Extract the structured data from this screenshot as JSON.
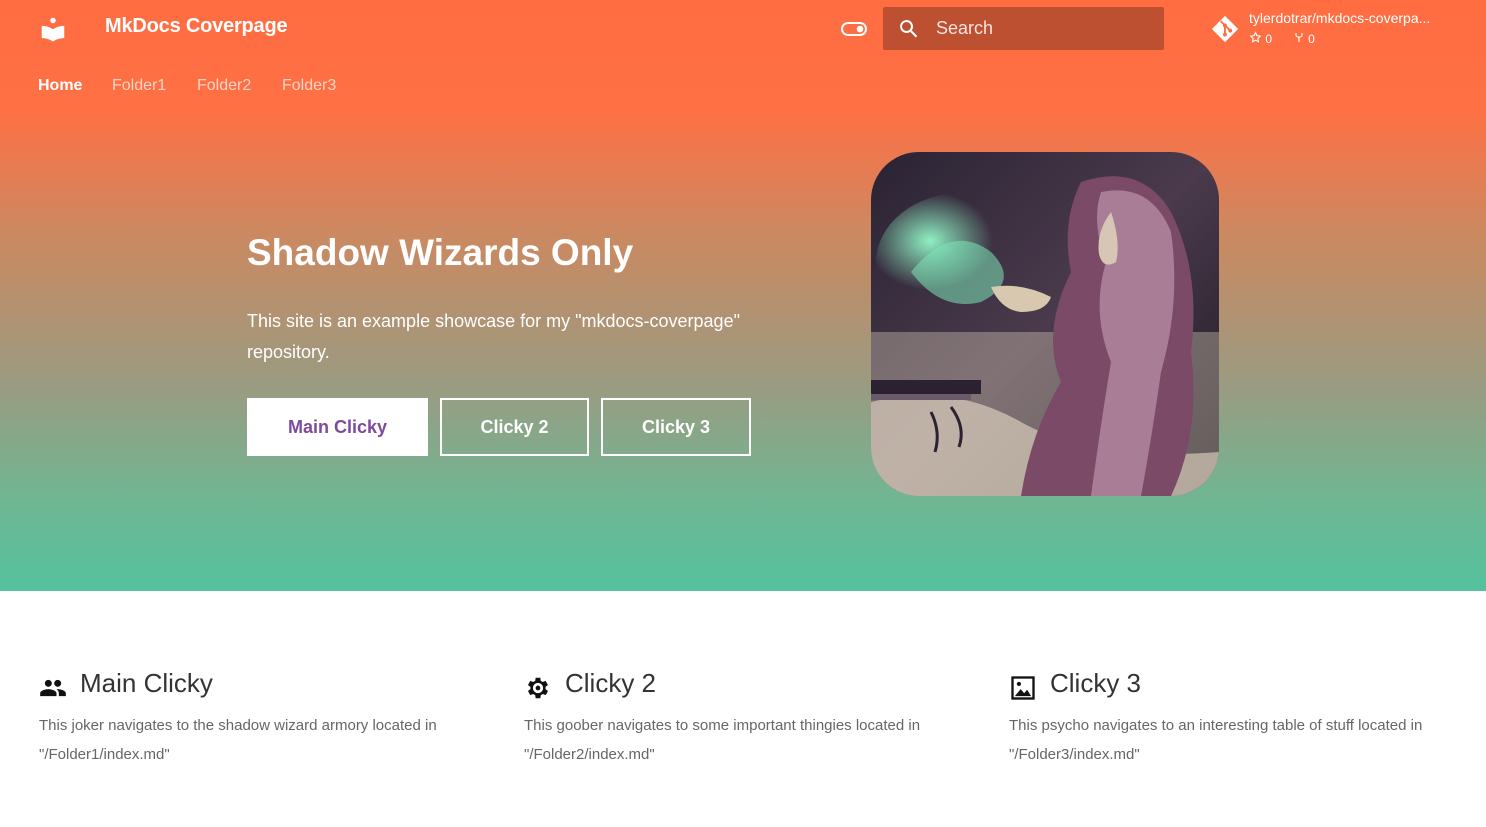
{
  "header": {
    "site_title": "MkDocs Coverpage",
    "search_placeholder": "Search",
    "repo": {
      "name": "tylerdotrar/mkdocs-coverpa...",
      "stars": "0",
      "forks": "0"
    }
  },
  "tabs": [
    {
      "label": "Home",
      "active": true
    },
    {
      "label": "Folder1",
      "active": false
    },
    {
      "label": "Folder2",
      "active": false
    },
    {
      "label": "Folder3",
      "active": false
    }
  ],
  "hero": {
    "title": "Shadow Wizards Only",
    "description": "This site is an example showcase for my \"mkdocs-coverpage\" repository.",
    "buttons": [
      {
        "label": "Main Clicky"
      },
      {
        "label": "Clicky 2"
      },
      {
        "label": "Clicky 3"
      }
    ]
  },
  "features": [
    {
      "icon": "users-icon",
      "title": "Main Clicky",
      "description": "This joker navigates to the shadow wizard armory located in \"/Folder1/index.md\""
    },
    {
      "icon": "cog-icon",
      "title": "Clicky 2",
      "description": "This goober navigates to some important thingies located in \"/Folder2/index.md\""
    },
    {
      "icon": "image-icon",
      "title": "Clicky 3",
      "description": "This psycho navigates to an interesting table of stuff located in \"/Folder3/index.md\""
    }
  ],
  "colors": {
    "primary": "#ff6d41",
    "accent": "#54c29d",
    "button_text": "#7e4a9b"
  }
}
